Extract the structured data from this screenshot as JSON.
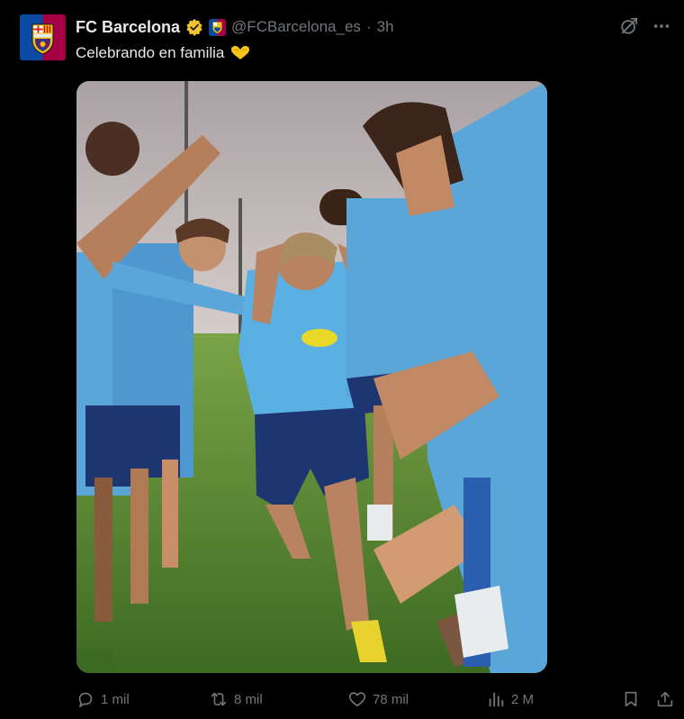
{
  "post": {
    "author_name": "FC Barcelona",
    "handle": "@FCBarcelona_es",
    "separator": "·",
    "time": "3h",
    "text": "Celebrando en familia",
    "text_emoji": "heart-hands",
    "accent_colors": {
      "blue": "#0b4aa2",
      "red": "#a50044",
      "gold": "#f2c011",
      "verified": "#f4c430"
    }
  },
  "metrics": {
    "replies": "1 mil",
    "reposts": "8 mil",
    "likes": "78 mil",
    "views": "2 M"
  }
}
